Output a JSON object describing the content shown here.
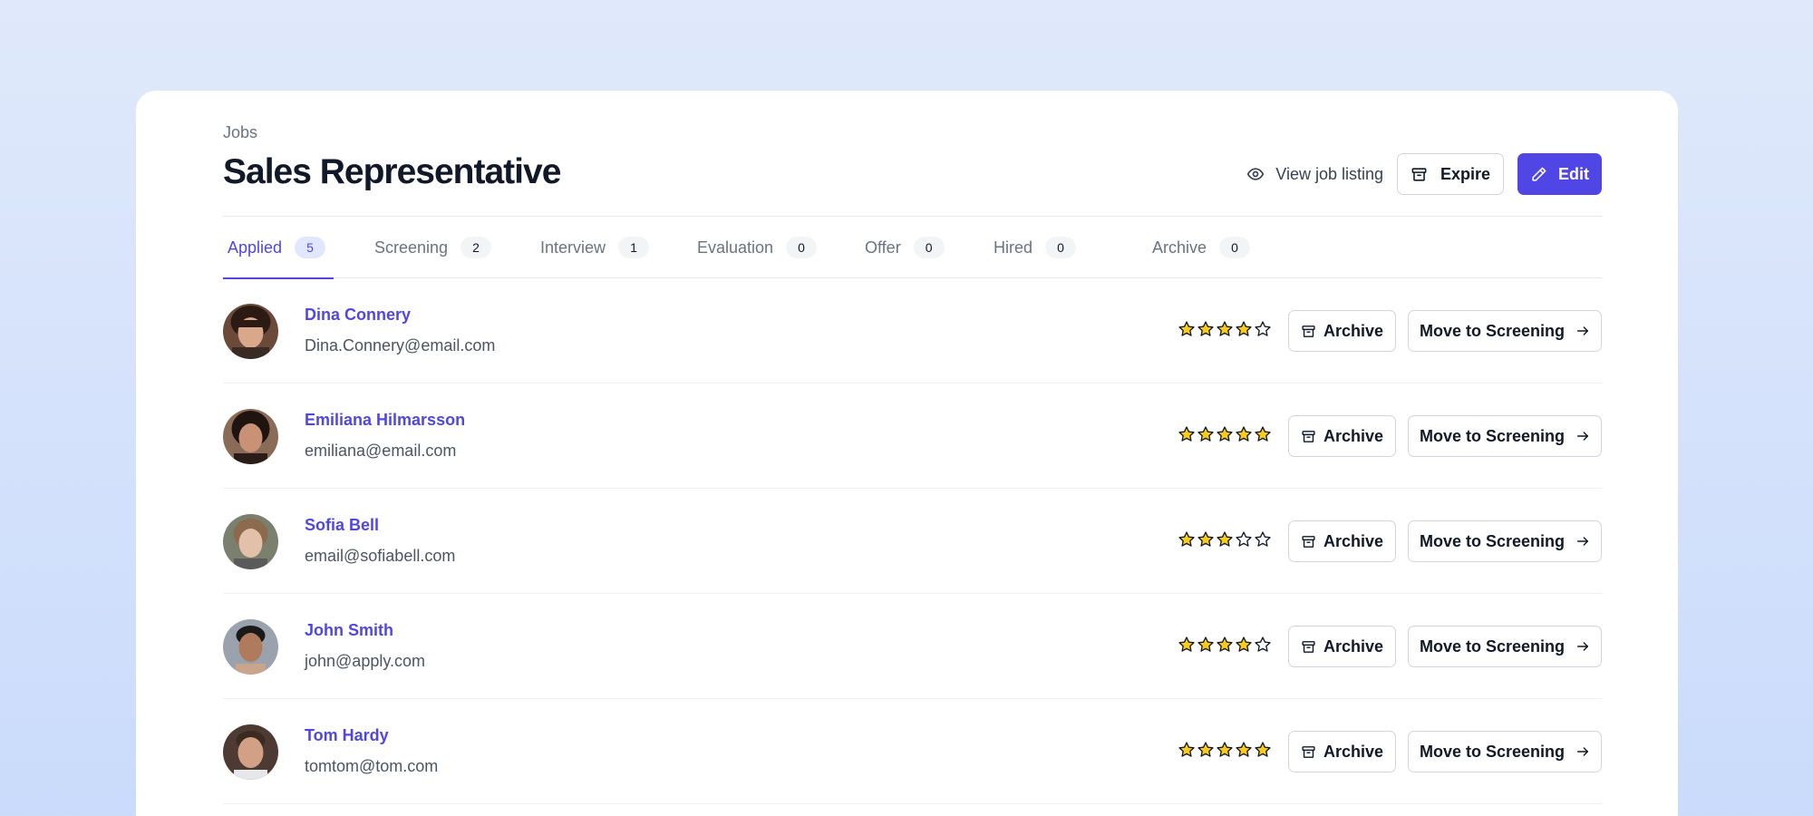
{
  "breadcrumb": "Jobs",
  "title": "Sales Representative",
  "actions": {
    "view_listing": "View job listing",
    "expire": "Expire",
    "edit": "Edit"
  },
  "tabs": [
    {
      "label": "Applied",
      "count": "5",
      "active": true
    },
    {
      "label": "Screening",
      "count": "2",
      "active": false
    },
    {
      "label": "Interview",
      "count": "1",
      "active": false
    },
    {
      "label": "Evaluation",
      "count": "0",
      "active": false
    },
    {
      "label": "Offer",
      "count": "0",
      "active": false
    },
    {
      "label": "Hired",
      "count": "0",
      "active": false
    },
    {
      "label": "Archive",
      "count": "0",
      "active": false
    }
  ],
  "candidates": [
    {
      "name": "Dina Connery",
      "email": "Dina.Connery@email.com",
      "rating": 4,
      "archive_label": "Archive",
      "move_label": "Move to Screening"
    },
    {
      "name": "Emiliana Hilmarsson",
      "email": "emiliana@email.com",
      "rating": 5,
      "archive_label": "Archive",
      "move_label": "Move to Screening"
    },
    {
      "name": "Sofia Bell",
      "email": "email@sofiabell.com",
      "rating": 3,
      "archive_label": "Archive",
      "move_label": "Move to Screening"
    },
    {
      "name": "John Smith",
      "email": "john@apply.com",
      "rating": 4,
      "archive_label": "Archive",
      "move_label": "Move to Screening"
    },
    {
      "name": "Tom Hardy",
      "email": "tomtom@tom.com",
      "rating": 5,
      "archive_label": "Archive",
      "move_label": "Move to Screening"
    }
  ],
  "colors": {
    "accent": "#4f46e5",
    "star_fill": "#facc15"
  }
}
